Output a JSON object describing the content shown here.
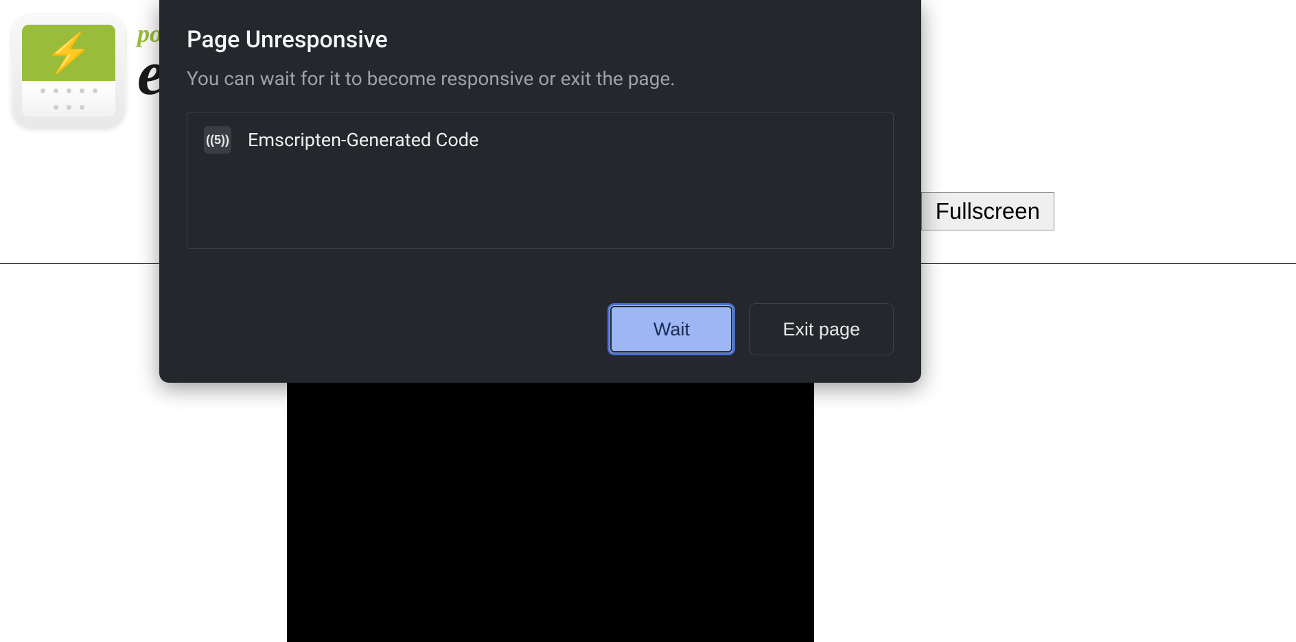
{
  "page": {
    "brand_small": "po",
    "brand_large": "e",
    "fullscreen_label": "Fullscreen"
  },
  "modal": {
    "title": "Page Unresponsive",
    "subtitle": "You can wait for it to become responsive or exit the page.",
    "process_name": "Emscripten-Generated Code",
    "process_icon_label": "((5))",
    "wait_label": "Wait",
    "exit_label": "Exit page"
  }
}
